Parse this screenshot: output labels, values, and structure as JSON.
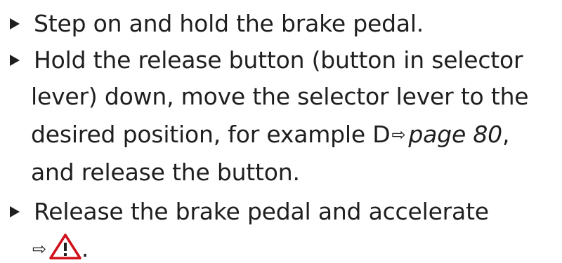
{
  "steps": [
    {
      "lines": [
        "Step on and hold the brake pedal."
      ]
    },
    {
      "lines": [
        "Hold the release button (button in selector",
        "lever) down, move the selector lever to the",
        "desired position, for example D",
        "and release the button."
      ],
      "reference": {
        "arrow": "⇨",
        "page_text": "page 80",
        "trailing": ","
      }
    },
    {
      "lines": [
        "Release the brake pedal and accelerate"
      ],
      "reference": {
        "arrow": "⇨",
        "icon": "warning-triangle-icon",
        "trailing": "."
      }
    }
  ],
  "colors": {
    "text": "#1f1f1f",
    "warning_red": "#d0101a"
  }
}
